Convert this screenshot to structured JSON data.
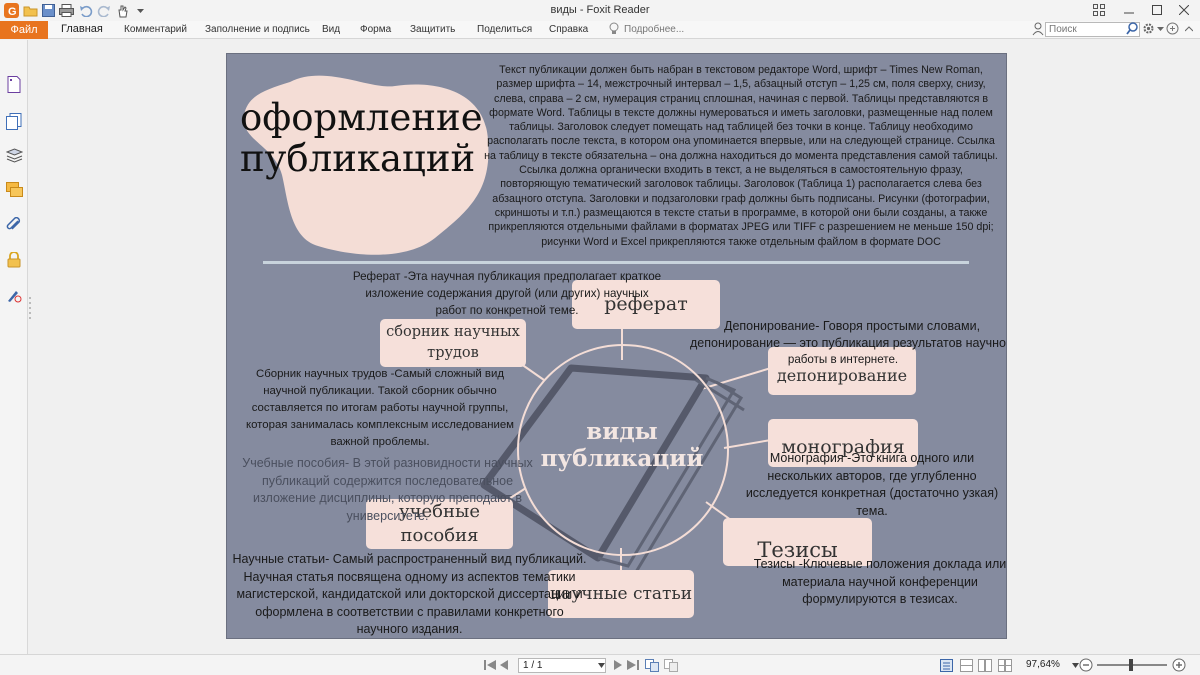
{
  "window": {
    "title": "виды - Foxit Reader"
  },
  "ribbon": {
    "file_label": "Файл",
    "tabs": [
      "Главная",
      "Комментарий",
      "Заполнение и подпись",
      "Вид",
      "Форма",
      "Защитить",
      "Поделиться",
      "Справка"
    ],
    "tell_me": "Подробнее...",
    "search_placeholder": "Поиск"
  },
  "document": {
    "main_title": "оформление публикаций",
    "intro_text": "Текст публикации должен быть набран в текстовом редакторе Word, шрифт – Times New Roman, размер шрифта – 14, межстрочный интервал – 1,5, абзацный отступ – 1,25 см, поля сверху, снизу, слева, справа – 2 см, нумерация страниц сплошная, начиная с первой. Таблицы представляются в формате Word. Таблицы в тексте должны нумероваться и иметь заголовки, размещенные над полем таблицы. Заголовок следует помещать над таблицей без точки в конце. Таблицу необходимо располагать после текста, в котором она упоминается впервые, или на следующей странице. Ссылка на таблицу в тексте обязательна – она должна находиться до момента представления самой таблицы. Ссылка должна органически входить в текст, а не выделяться в самостоятельную фразу, повторяющую тематический заголовок таблицы. Заголовок (Таблица 1) располагается слева без абзацного отступа. Заголовки и подзаголовки граф должны быть подписаны. Рисунки (фотографии, скриншоты и т.п.) размещаются в тексте статьи в программе, в которой они были созданы, а также прикрепляются отдельными файлами в форматах JPEG или TIFF с разрешением не меньше 150 dpi; рисунки Word и Excel прикрепляются также отдельным файлом в формате DOC",
    "center_title": "виды публикаций",
    "pills": {
      "referat": "реферат",
      "sbornik": "сборник научных трудов",
      "deponirovanie": "депонирование",
      "monografiya": "монография",
      "tezisy": "Тезисы",
      "nauchnye_stati": "научные статьи",
      "uchebnye_posobiya": "учебные пособия"
    },
    "descriptions": {
      "referat": "Реферат -Эта научная публикация предполагает краткое изложение содержания другой (или других) научных работ по конкретной теме.",
      "deponirovanie_line1": "Депонирование- Говоря простыми словами,",
      "deponirovanie_line2": "депонирование — это публикация результатов научно",
      "deponirovanie_line3": "работы в интернете.",
      "sbornik": "Сборник научных трудов -Самый сложный вид научной публикации. Такой сборник обычно составляется по итогам работы научной группы, которая занималась комплексным исследованием важной проблемы.",
      "uchebnye": "Учебные пособия- В этой разновидности научных публикаций содержится последовательное изложение дисциплины, которую преподают в университете.",
      "monografiya": "Монография -Это книга одного или нескольких авторов, где углубленно исследуется конкретная (достаточно узкая) тема.",
      "nauchnye": "Научные статьи- Самый распространенный вид публикаций. Научная статья посвящена одному из аспектов тематики магистерской, кандидатской или докторской диссертации и оформлена в соответствии с правилами конкретного научного издания.",
      "tezisy": "Тезисы -Ключевые положения доклада или материала научной конференции формулируются в тезисах."
    }
  },
  "statusbar": {
    "page_field": "1 / 1",
    "zoom": "97,64%"
  },
  "colors": {
    "accent": "#e8741e",
    "page_bg": "#858b9f",
    "pill_bg": "#f6e0da"
  }
}
